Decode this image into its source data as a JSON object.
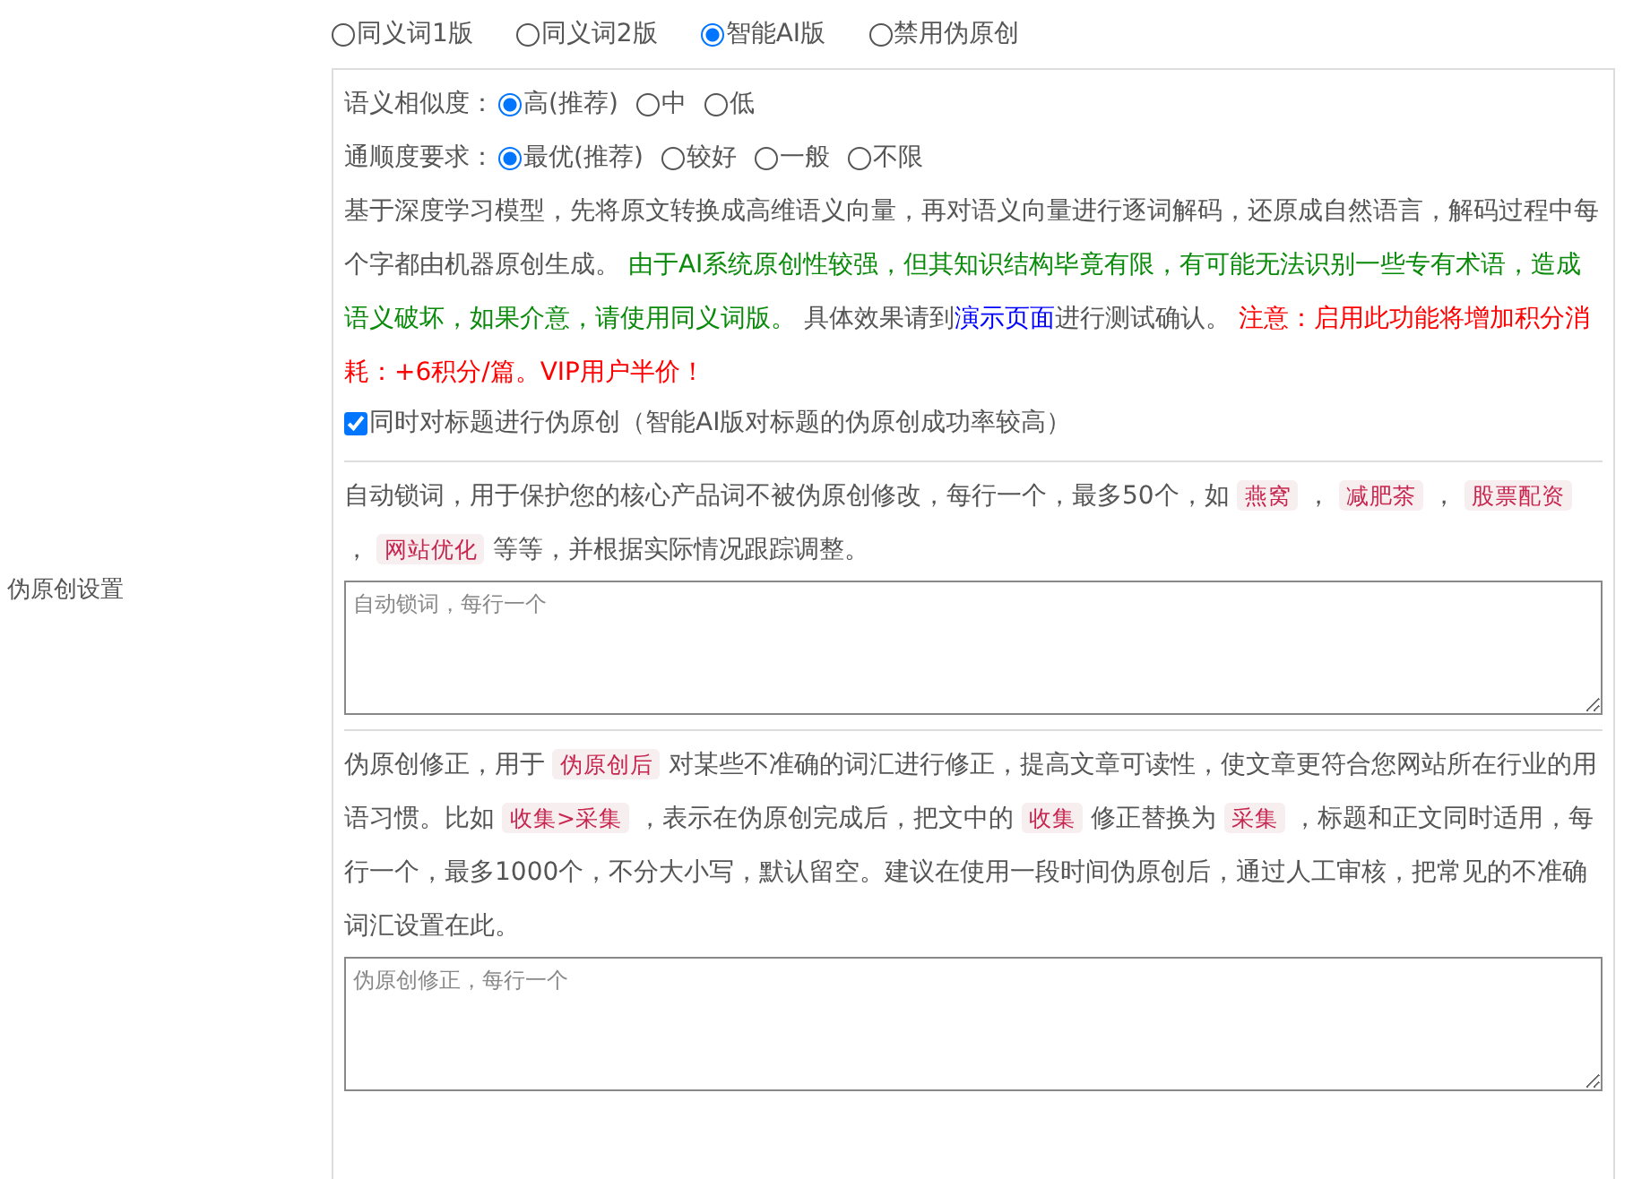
{
  "section_label": "伪原创设置",
  "mode_options": [
    {
      "label": "同义词1版",
      "selected": false
    },
    {
      "label": "同义词2版",
      "selected": false
    },
    {
      "label": "智能AI版",
      "selected": true
    },
    {
      "label": "禁用伪原创",
      "selected": false
    }
  ],
  "similarity": {
    "label": "语义相似度：",
    "options": [
      {
        "label": "高(推荐)",
        "selected": true
      },
      {
        "label": "中",
        "selected": false
      },
      {
        "label": "低",
        "selected": false
      }
    ]
  },
  "fluency": {
    "label": "通顺度要求：",
    "options": [
      {
        "label": "最优(推荐)",
        "selected": true
      },
      {
        "label": "较好",
        "selected": false
      },
      {
        "label": "一般",
        "selected": false
      },
      {
        "label": "不限",
        "selected": false
      }
    ]
  },
  "description": [
    {
      "kind": "plain",
      "text": "基于深度学习模型，先将原文转换成高维语义向量，再对语义向量进行逐词解码，还原成自然语言，解码过程中每个字都由机器原创生成。 "
    },
    {
      "kind": "green",
      "text": "由于AI系统原创性较强，但其知识结构毕竟有限，有可能无法识别一些专有术语，造成语义破坏，如果介意，请使用同义词版。"
    },
    {
      "kind": "plain",
      "text": " 具体效果请到"
    },
    {
      "kind": "link",
      "text": "演示页面"
    },
    {
      "kind": "plain",
      "text": "进行测试确认。 "
    },
    {
      "kind": "red",
      "text": "注意：启用此功能将增加积分消耗：+6积分/篇。VIP用户半价！"
    }
  ],
  "title_checkbox": {
    "label": "同时对标题进行伪原创（智能AI版对标题的伪原创成功率较高）",
    "checked": true
  },
  "lock_words": {
    "description": [
      {
        "kind": "plain",
        "text": "自动锁词，用于保护您的核心产品词不被伪原创修改，每行一个，最多50个，如 "
      },
      {
        "kind": "code",
        "text": "燕窝"
      },
      {
        "kind": "plain",
        "text": " ， "
      },
      {
        "kind": "code",
        "text": "减肥茶"
      },
      {
        "kind": "plain",
        "text": " ， "
      },
      {
        "kind": "code",
        "text": "股票配资"
      },
      {
        "kind": "plain",
        "text": " ， "
      },
      {
        "kind": "code",
        "text": "网站优化"
      },
      {
        "kind": "plain",
        "text": " 等等，并根据实际情况跟踪调整。"
      }
    ],
    "placeholder": "自动锁词，每行一个"
  },
  "correction": {
    "description": [
      {
        "kind": "plain",
        "text": "伪原创修正，用于 "
      },
      {
        "kind": "code",
        "text": "伪原创后"
      },
      {
        "kind": "plain",
        "text": " 对某些不准确的词汇进行修正，提高文章可读性，使文章更符合您网站所在行业的用语习惯。比如 "
      },
      {
        "kind": "code",
        "text": "收集>采集"
      },
      {
        "kind": "plain",
        "text": " ，表示在伪原创完成后，把文中的 "
      },
      {
        "kind": "code",
        "text": "收集"
      },
      {
        "kind": "plain",
        "text": " 修正替换为 "
      },
      {
        "kind": "code",
        "text": "采集"
      },
      {
        "kind": "plain",
        "text": " ，标题和正文同时适用，每行一个，最多1000个，不分大小写，默认留空。建议在使用一段时间伪原创后，通过人工审核，把常见的不准确词汇设置在此。"
      }
    ],
    "placeholder": "伪原创修正，每行一个"
  }
}
